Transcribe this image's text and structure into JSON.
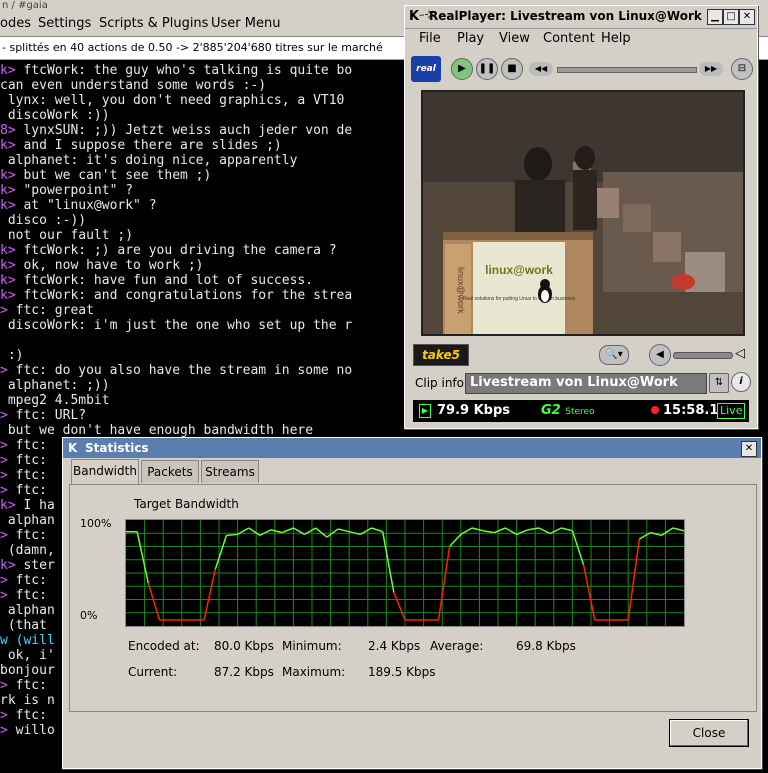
{
  "terminal": {
    "title": "n / #gaia",
    "menu": [
      "odes",
      "Settings",
      "Scripts & Plugins",
      "User Menu"
    ],
    "status": "- splittés en 40 actions de 0.50 -> 2'885'204'680 titres sur le marché",
    "lines": [
      {
        "p": "k>",
        "t": " ftcWork: the guy who's talking is quite bo"
      },
      {
        "p": "",
        "t": "can even understand some words :-)"
      },
      {
        "p": "",
        "t": " lynx: well, you don't need graphics, a VT10"
      },
      {
        "p": "",
        "t": " discoWork :))"
      },
      {
        "p": "8>",
        "t": " lynxSUN: ;)) Jetzt weiss auch jeder von de"
      },
      {
        "p": "k>",
        "t": " and I suppose there are slides ;)"
      },
      {
        "p": "",
        "t": " alphanet: it's doing nice, apparently"
      },
      {
        "p": "k>",
        "t": " but we can't see them ;)"
      },
      {
        "p": "k>",
        "t": " \"powerpoint\" ?"
      },
      {
        "p": "k>",
        "t": " at \"linux@work\" ?"
      },
      {
        "p": "",
        "t": " disco :-))"
      },
      {
        "p": "",
        "t": " not our fault ;)"
      },
      {
        "p": "k>",
        "t": " ftcWork: ;) are you driving the camera ?"
      },
      {
        "p": "k>",
        "t": " ok, now have to work ;)"
      },
      {
        "p": "k>",
        "t": " ftcWork: have fun and lot of success."
      },
      {
        "p": "k>",
        "t": " ftcWork: and congratulations for the strea"
      },
      {
        "p": ">",
        "t": " ftc: great"
      },
      {
        "p": "",
        "t": " discoWork: i'm just the one who set up the r"
      },
      {
        "p": "",
        "t": ""
      },
      {
        "p": "",
        "t": " :)"
      },
      {
        "p": ">",
        "t": " ftc: do you also have the stream in some no"
      },
      {
        "p": "",
        "t": " alphanet: ;))"
      },
      {
        "p": "",
        "t": " mpeg2 4.5mbit"
      },
      {
        "p": ">",
        "t": " ftc: URL?"
      },
      {
        "p": "",
        "t": " but we don't have enough bandwidth here"
      },
      {
        "p": ">",
        "t": " ftc:"
      },
      {
        "p": ">",
        "t": " ftc:"
      },
      {
        "p": ">",
        "t": " ftc:"
      },
      {
        "p": ">",
        "t": " ftc:"
      },
      {
        "p": "k>",
        "t": " I ha"
      },
      {
        "p": "",
        "t": " alphan"
      },
      {
        "p": ">",
        "t": " ftc:"
      },
      {
        "p": "",
        "t": " (damn,"
      },
      {
        "p": "k>",
        "t": " ster"
      },
      {
        "p": ">",
        "t": " ftc:"
      },
      {
        "p": ">",
        "t": " ftc:"
      },
      {
        "p": "",
        "t": " alphan"
      },
      {
        "p": "",
        "t": " (that"
      },
      {
        "p": "w",
        "t": " (will",
        "c": true
      },
      {
        "p": "",
        "t": " ok, i'"
      },
      {
        "p": "",
        "t": "bonjour"
      },
      {
        "p": ">",
        "t": " ftc:"
      },
      {
        "p": "",
        "t": "rk is n"
      },
      {
        "p": ">",
        "t": " ftc:"
      },
      {
        "p": ">",
        "t": " willo"
      }
    ]
  },
  "realplayer": {
    "title": "RealPlayer: Livestream von Linux@Work",
    "menu": [
      "File",
      "Play",
      "View",
      "Content",
      "Help"
    ],
    "logo": "real",
    "take5": "take5",
    "clip_label": "Clip info:",
    "clip_value": "Livestream von Linux@Work",
    "bitrate": "79.9 Kbps",
    "codec": "G2",
    "codec_sub": "Stereo",
    "time": "15:58.1",
    "live": "Live",
    "video": {
      "banner": "linux@work",
      "sub": "Real solutions for putting Linux to work in business",
      "side": "linux@work"
    }
  },
  "statistics": {
    "title": "Statistics",
    "tabs": [
      "Bandwidth",
      "Packets",
      "Streams"
    ],
    "active_tab": 0,
    "chart_label": "Target Bandwidth",
    "close": "Close",
    "stats": {
      "encoded_label": "Encoded at:",
      "encoded_value": "80.0 Kbps",
      "minimum_label": "Minimum:",
      "minimum_value": "2.4 Kbps",
      "average_label": "Average:",
      "average_value": "69.8 Kbps",
      "current_label": "Current:",
      "current_value": "87.2 Kbps",
      "maximum_label": "Maximum:",
      "maximum_value": "189.5 Kbps"
    }
  },
  "chart_data": {
    "type": "line",
    "title": "Target Bandwidth",
    "ylim": [
      0,
      100
    ],
    "yticks": [
      "100%",
      "0%"
    ],
    "grid": true,
    "colors": {
      "high": "#66ff33",
      "low": "#ff2200",
      "grid": "#1a8a1a"
    },
    "x": [
      0,
      2,
      4,
      6,
      8,
      10,
      12,
      14,
      16,
      18,
      20,
      22,
      24,
      26,
      28,
      30,
      32,
      34,
      36,
      38,
      40,
      42,
      44,
      46,
      48,
      50,
      52,
      54,
      56,
      58,
      60,
      62,
      64,
      66,
      68,
      70,
      72,
      74,
      76,
      78,
      80,
      82,
      84,
      86,
      88,
      90,
      92,
      94,
      96,
      98,
      100
    ],
    "values": [
      96,
      96,
      40,
      0,
      0,
      0,
      0,
      0,
      55,
      92,
      93,
      100,
      92,
      98,
      95,
      100,
      93,
      100,
      90,
      99,
      96,
      93,
      100,
      96,
      30,
      0,
      0,
      0,
      0,
      80,
      93,
      100,
      97,
      95,
      100,
      93,
      98,
      100,
      94,
      100,
      97,
      60,
      0,
      0,
      0,
      0,
      88,
      95,
      92,
      100,
      97
    ]
  }
}
